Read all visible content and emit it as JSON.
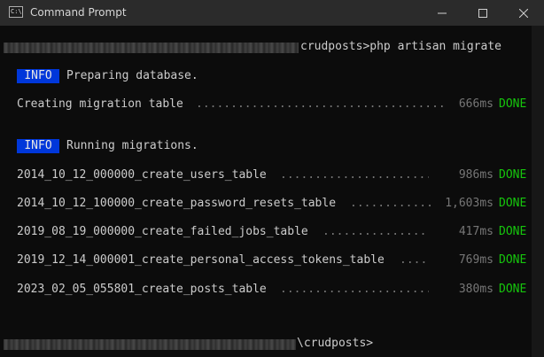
{
  "window": {
    "title": "Command Prompt",
    "icon": "cmd-icon",
    "icon_glyph": "C:\\",
    "controls": [
      "minimize-icon",
      "maximize-icon",
      "close-icon"
    ]
  },
  "terminal": {
    "command_prompt": "crudposts>php artisan migrate",
    "final_prompt": "\\crudposts>",
    "info_badge": "INFO",
    "preparing_message": "Preparing database.",
    "running_message": "Running migrations.",
    "setup_step": {
      "name": "Creating migration table",
      "duration": "666ms",
      "status": "DONE"
    },
    "migrations": [
      {
        "name": "2014_10_12_000000_create_users_table",
        "duration": "986ms",
        "status": "DONE"
      },
      {
        "name": "2014_10_12_100000_create_password_resets_table",
        "duration": "1,603ms",
        "status": "DONE"
      },
      {
        "name": "2019_08_19_000000_create_failed_jobs_table",
        "duration": "417ms",
        "status": "DONE"
      },
      {
        "name": "2019_12_14_000001_create_personal_access_tokens_table",
        "duration": "769ms",
        "status": "DONE"
      },
      {
        "name": "2023_02_05_055801_create_posts_table",
        "duration": "380ms",
        "status": "DONE"
      }
    ]
  },
  "colors": {
    "background": "#0c0c0c",
    "titlebar": "#2b2b2b",
    "badge": "#0037da",
    "done": "#16c60c",
    "dim": "#767676"
  }
}
